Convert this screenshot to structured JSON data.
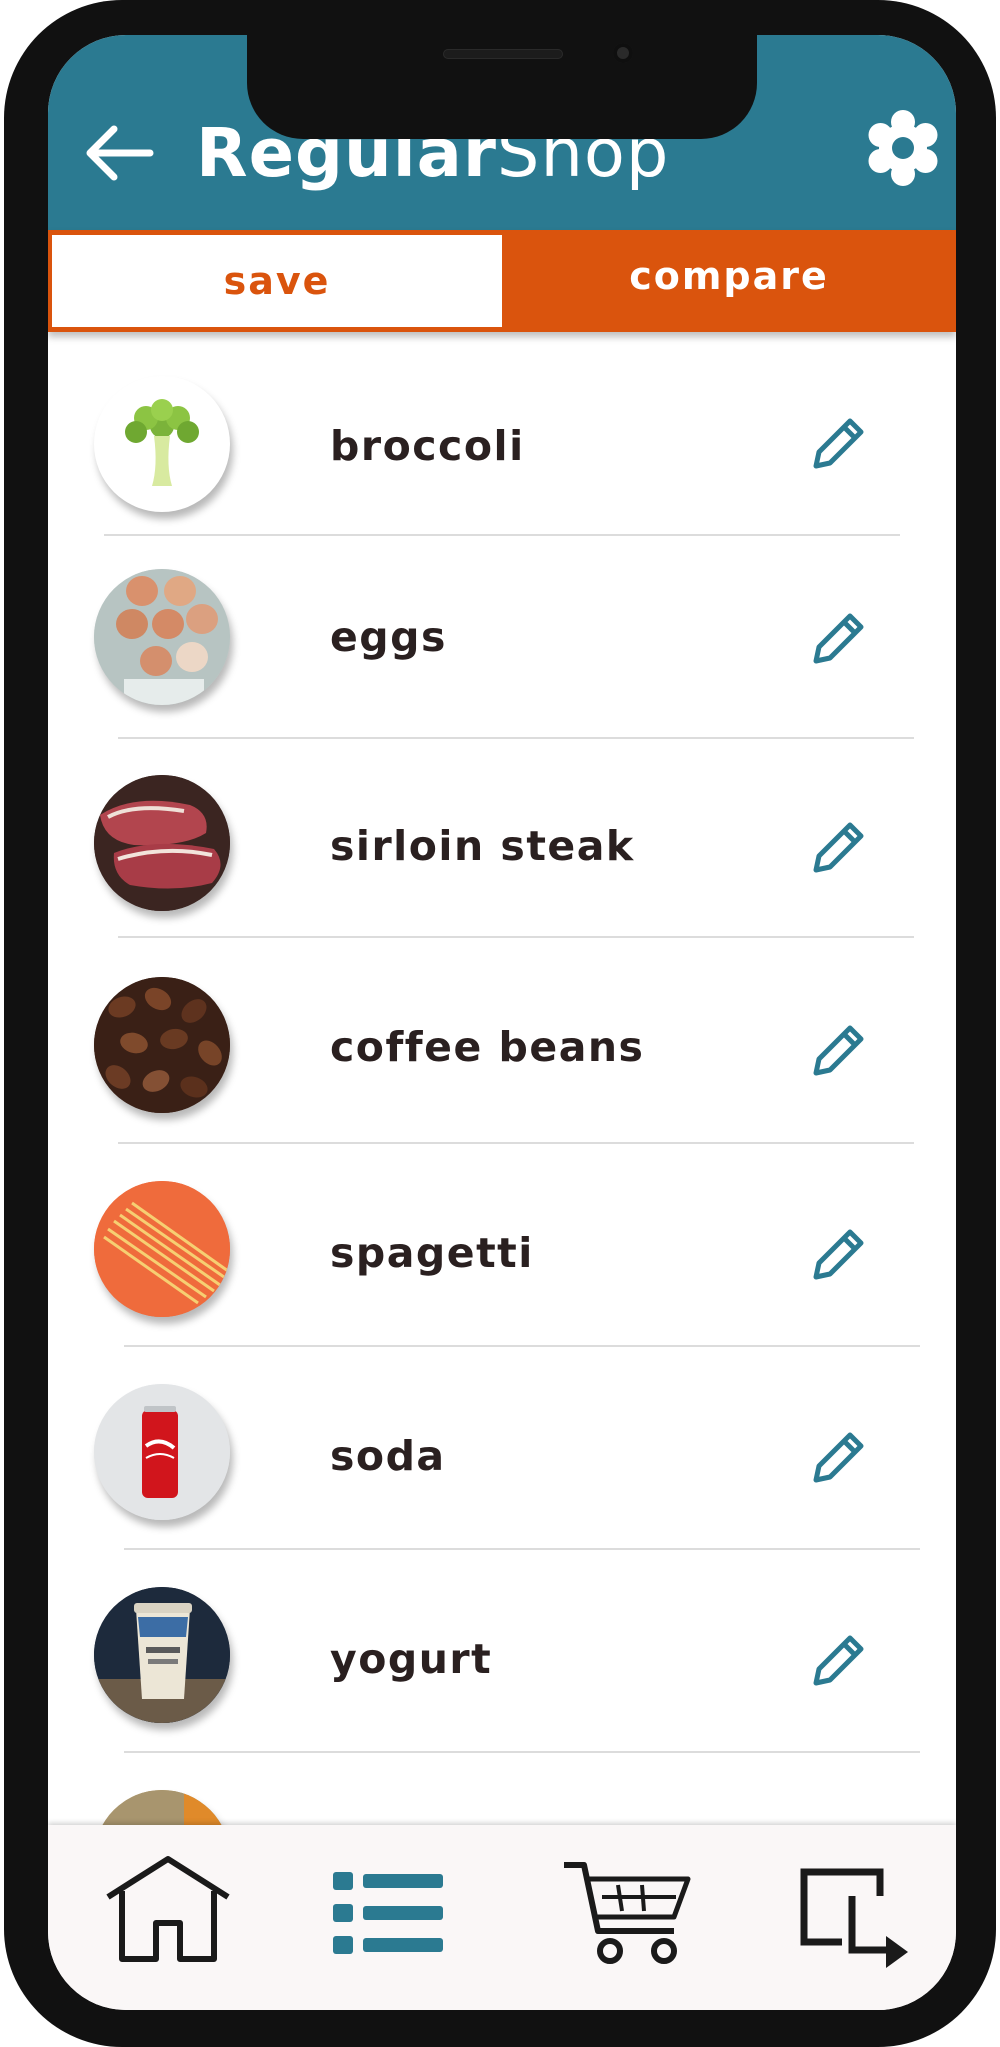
{
  "app": {
    "title_bold": "Regular",
    "title_light": "Shop"
  },
  "header": {
    "back_icon": "arrow-left-icon",
    "settings_icon": "gear-icon"
  },
  "tabs": [
    {
      "label": "save",
      "active": true
    },
    {
      "label": "compare",
      "active": false
    }
  ],
  "items": [
    {
      "name": "broccoli",
      "thumbnail": "broccoli-image",
      "action_icon": "pencil-icon"
    },
    {
      "name": "eggs",
      "thumbnail": "eggs-image",
      "action_icon": "pencil-icon"
    },
    {
      "name": "sirloin steak",
      "thumbnail": "steak-image",
      "action_icon": "pencil-icon"
    },
    {
      "name": "coffee beans",
      "thumbnail": "coffee-beans-image",
      "action_icon": "pencil-icon"
    },
    {
      "name": "spagetti",
      "thumbnail": "spaghetti-image",
      "action_icon": "pencil-icon"
    },
    {
      "name": "soda",
      "thumbnail": "soda-can-image",
      "action_icon": "pencil-icon"
    },
    {
      "name": "yogurt",
      "thumbnail": "yogurt-image",
      "action_icon": "pencil-icon"
    }
  ],
  "bottom_nav": [
    {
      "icon": "home-icon",
      "active": false
    },
    {
      "icon": "list-icon",
      "active": true
    },
    {
      "icon": "cart-icon",
      "active": false
    },
    {
      "icon": "exit-icon",
      "active": false
    }
  ],
  "colors": {
    "header": "#2b7a91",
    "accent": "#da540d",
    "icon_teal": "#2b7a91",
    "text": "#2a2020",
    "frame": "#111111"
  }
}
